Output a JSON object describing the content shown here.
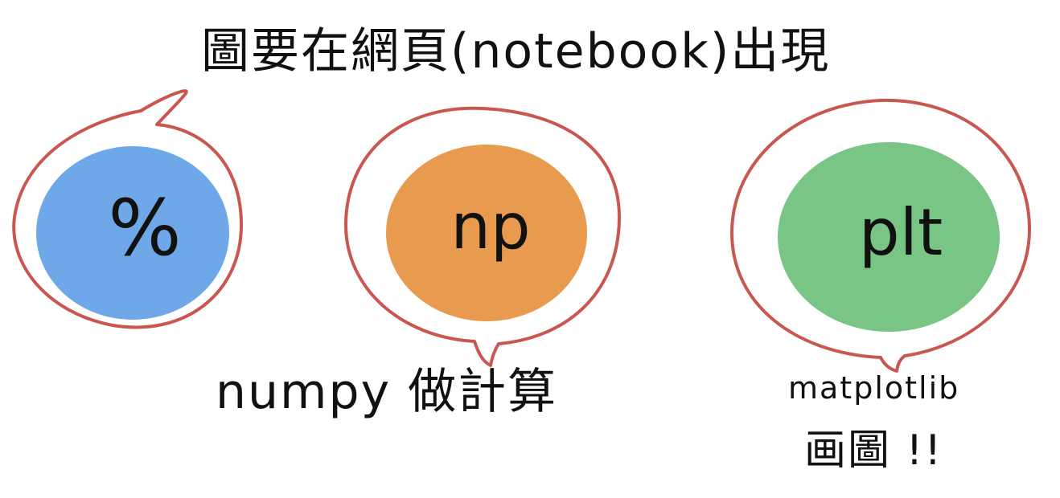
{
  "top_caption": "圖要在網頁(notebook)出現",
  "bubbles": [
    {
      "text": "%",
      "fill": "#6FA8E8"
    },
    {
      "text": "np",
      "fill": "#E89B4E"
    },
    {
      "text": "plt",
      "fill": "#78C585"
    }
  ],
  "outline_color": "#C9574F",
  "captions": {
    "numpy": "numpy 做計算",
    "matplotlib_line1": "matplotlib",
    "matplotlib_line2": "画圖 !!"
  }
}
